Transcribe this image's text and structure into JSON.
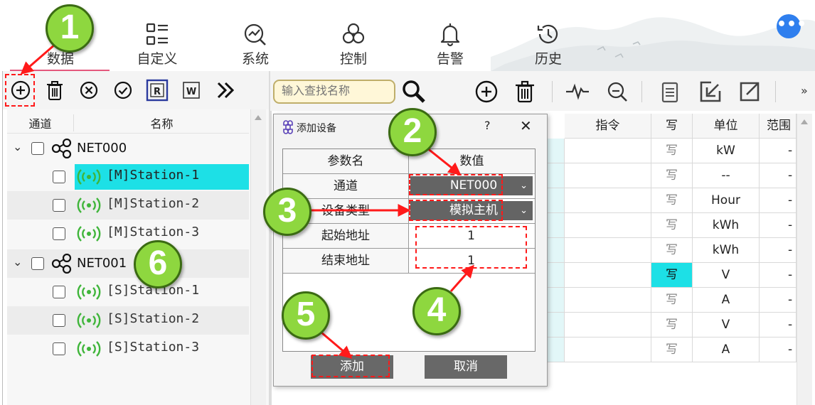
{
  "nav": {
    "items": [
      {
        "label": "数据",
        "icon": "database-icon"
      },
      {
        "label": "自定义",
        "icon": "custom-list-icon"
      },
      {
        "label": "系统",
        "icon": "system-settings-icon"
      },
      {
        "label": "控制",
        "icon": "biohazard-control-icon"
      },
      {
        "label": "告警",
        "icon": "bell-icon"
      },
      {
        "label": "历史",
        "icon": "history-clock-icon"
      }
    ],
    "active": "数据",
    "more_label": "•••",
    "accent_color": "#e4577c"
  },
  "tree": {
    "headers": {
      "channel": "通道",
      "name": "名称"
    },
    "nodes": [
      {
        "label": "NET000",
        "stations": [
          "[M]Station-1",
          "[M]Station-2",
          "[M]Station-3"
        ]
      },
      {
        "label": "NET001",
        "stations": [
          "[S]Station-1",
          "[S]Station-2",
          "[S]Station-3"
        ]
      }
    ],
    "selected": "[M]Station-1",
    "selected_color": "#1de0e6"
  },
  "right_toolbar": {
    "search_placeholder": "输入查找名称",
    "overflow_label": "»"
  },
  "table": {
    "headers": {
      "command": "指令",
      "write": "写",
      "unit": "单位",
      "range": "范围"
    },
    "rows": [
      {
        "write": "写",
        "unit": "kW",
        "range": "--"
      },
      {
        "write": "写",
        "unit": "--",
        "range": "--"
      },
      {
        "write": "写",
        "unit": "Hour",
        "range": "--"
      },
      {
        "write": "写",
        "unit": "kWh",
        "range": "--"
      },
      {
        "write": "写",
        "unit": "kWh",
        "range": "--"
      },
      {
        "write": "写",
        "unit": "V",
        "range": "--"
      },
      {
        "write": "写",
        "unit": "A",
        "range": "--"
      },
      {
        "write": "写",
        "unit": "V",
        "range": "--"
      },
      {
        "write": "写",
        "unit": "A",
        "range": "--"
      }
    ],
    "highlight_write_row": 5
  },
  "dialog": {
    "title": "添加设备",
    "help": "?",
    "close": "✕",
    "col_param": "参数名",
    "col_value": "数值",
    "params": [
      {
        "name": "通道",
        "value": "NET000"
      },
      {
        "name": "设备类型",
        "value": "模拟主机"
      },
      {
        "name": "起始地址",
        "value": "1"
      },
      {
        "name": "结束地址",
        "value": "1"
      }
    ],
    "add_button": "添加",
    "cancel_button": "取消"
  },
  "annotations": {
    "badges": [
      "1",
      "2",
      "3",
      "4",
      "5",
      "6"
    ],
    "badge_color": "#8ed73f",
    "highlight_color": "#ff1a1a"
  }
}
